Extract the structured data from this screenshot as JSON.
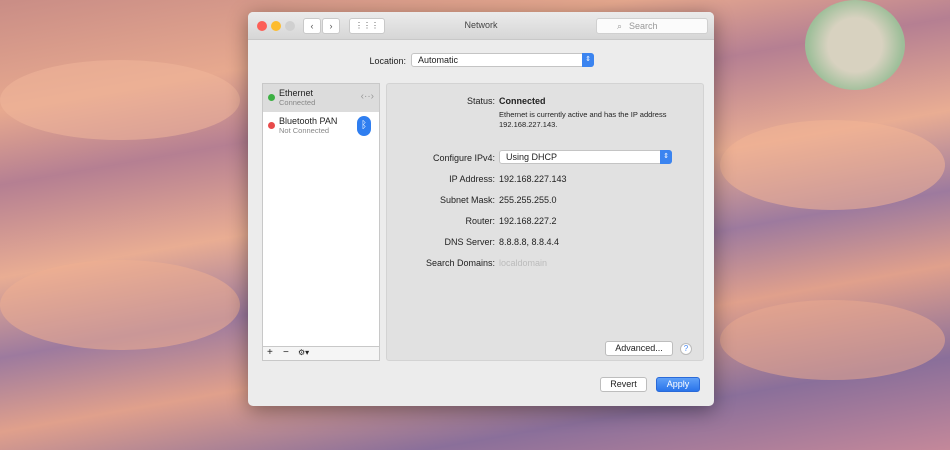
{
  "window": {
    "title": "Network",
    "search_placeholder": "Search"
  },
  "location": {
    "label": "Location:",
    "value": "Automatic"
  },
  "services": [
    {
      "name": "Ethernet",
      "status": "Connected",
      "status_color": "#3cb043",
      "icon": "ethernet-arrows-icon"
    },
    {
      "name": "Bluetooth PAN",
      "status": "Not Connected",
      "status_color": "#e84a4a",
      "icon": "bluetooth-icon"
    }
  ],
  "list_controls": {
    "add": "+",
    "remove": "−",
    "gear": "⚙▾"
  },
  "detail": {
    "status_label": "Status:",
    "status_value": "Connected",
    "status_desc": "Ethernet is currently active and has the IP address 192.168.227.143.",
    "configure_label": "Configure IPv4:",
    "configure_value": "Using DHCP",
    "ip_label": "IP Address:",
    "ip_value": "192.168.227.143",
    "subnet_label": "Subnet Mask:",
    "subnet_value": "255.255.255.0",
    "router_label": "Router:",
    "router_value": "192.168.227.2",
    "dns_label": "DNS Server:",
    "dns_value": "8.8.8.8, 8.8.4.4",
    "domains_label": "Search Domains:",
    "domains_value": "localdomain",
    "advanced": "Advanced...",
    "help": "?"
  },
  "footer": {
    "revert": "Revert",
    "apply": "Apply"
  },
  "colors": {
    "accent": "#3b84f0"
  }
}
